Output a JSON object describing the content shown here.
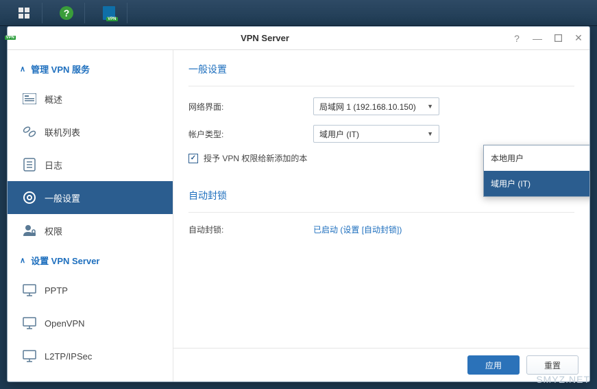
{
  "window": {
    "title": "VPN Server"
  },
  "sidebar": {
    "section1": {
      "title": "管理 VPN 服务"
    },
    "items1": [
      {
        "label": "概述"
      },
      {
        "label": "联机列表"
      },
      {
        "label": "日志"
      },
      {
        "label": "一般设置"
      },
      {
        "label": "权限"
      }
    ],
    "section2": {
      "title": "设置 VPN Server"
    },
    "items2": [
      {
        "label": "PPTP"
      },
      {
        "label": "OpenVPN"
      },
      {
        "label": "L2TP/IPSec"
      }
    ]
  },
  "general": {
    "heading": "一般设置",
    "iface_label": "网络界面:",
    "iface_value": "局域网 1 (192.168.10.150)",
    "acct_label": "帐户类型:",
    "acct_value": "域用户 (IT)",
    "grant_label": "授予 VPN 权限给新添加的本",
    "options": {
      "local": "本地用户",
      "domain": "域用户 (IT)"
    }
  },
  "autoblock": {
    "heading": "自动封锁",
    "label": "自动封锁:",
    "status": "已启动",
    "link_text": "设置 [自动封锁]",
    "paren_open": " (",
    "paren_close": ")"
  },
  "footer": {
    "apply": "应用",
    "reset": "重置"
  },
  "watermark": "SMYZ.NET"
}
